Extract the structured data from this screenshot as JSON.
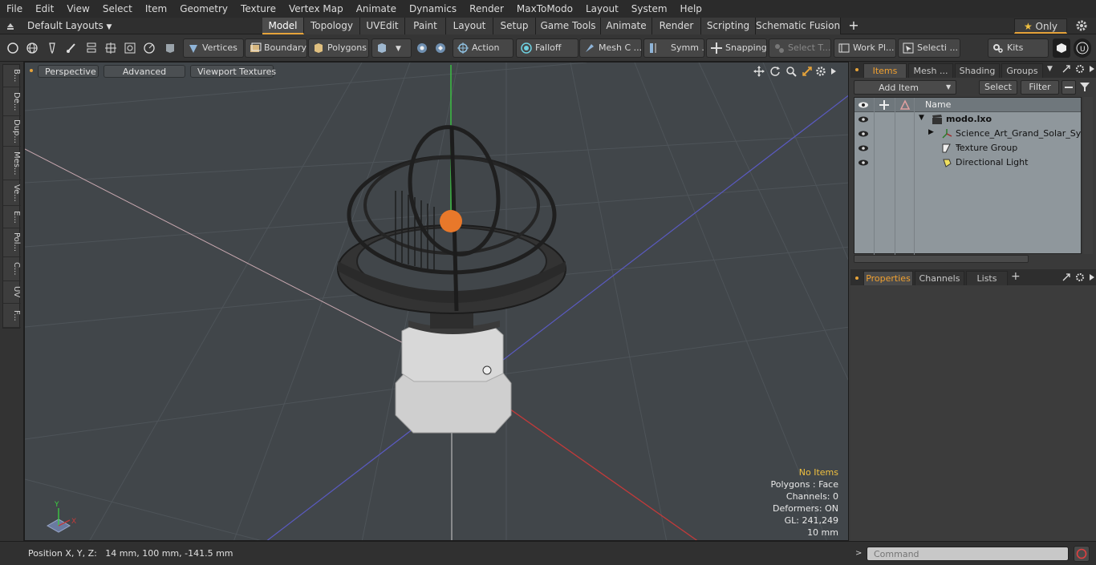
{
  "menu": [
    "File",
    "Edit",
    "View",
    "Select",
    "Item",
    "Geometry",
    "Texture",
    "Vertex Map",
    "Animate",
    "Dynamics",
    "Render",
    "MaxToModo",
    "Layout",
    "System",
    "Help"
  ],
  "layout_selector": "Default Layouts",
  "layout_tabs": [
    "Model",
    "Topology",
    "UVEdit",
    "Paint",
    "Layout",
    "Setup",
    "Game Tools",
    "Animate",
    "Render",
    "Scripting",
    "Schematic Fusion"
  ],
  "active_layout_tab": "Model",
  "only_label": "Only",
  "toolbar": {
    "vertices": "Vertices",
    "boundary": "Boundary",
    "polygons": "Polygons",
    "action": "Action",
    "falloff": "Falloff",
    "mesh": "Mesh C ...",
    "symm": "Symm ...",
    "snapping": "Snapping",
    "select_t": "Select T...",
    "work_pl": "Work Pl...",
    "selecti": "Selecti ...",
    "kits": "Kits"
  },
  "left_tabs": [
    "B...",
    "De...",
    "Dup...",
    "Mes...",
    "Ve...",
    "E...",
    "Pol...",
    "C...",
    "UV",
    "F..."
  ],
  "viewport": {
    "perspective": "Perspective",
    "advanced": "Advanced",
    "textures": "Viewport Textures",
    "info": {
      "no_items": "No Items",
      "polygons": "Polygons : Face",
      "channels": "Channels: 0",
      "deformers": "Deformers: ON",
      "gl": "GL: 241,249",
      "scale": "10 mm"
    },
    "axis_labels": {
      "y": "Y",
      "x": "X"
    }
  },
  "right_panel": {
    "tabs": [
      "Items",
      "Mesh ...",
      "Shading",
      "Groups"
    ],
    "add_item": "Add Item",
    "select": "Select",
    "filter": "Filter",
    "name_header": "Name",
    "items": [
      {
        "label": "modo.lxo",
        "bold": true
      },
      {
        "label": "Science_Art_Grand_Solar_Sy ...",
        "bold": false
      },
      {
        "label": "Texture Group",
        "bold": false
      },
      {
        "label": "Directional Light",
        "bold": false
      }
    ],
    "bottom_tabs": [
      "Properties",
      "Channels",
      "Lists"
    ]
  },
  "status": {
    "position": "Position X, Y, Z:   14 mm, 100 mm, -141.5 mm",
    "command_placeholder": "Command"
  },
  "colors": {
    "accent": "#e6a33a",
    "items_bg": "#8f979c",
    "viewport_bg": "#41464a"
  }
}
